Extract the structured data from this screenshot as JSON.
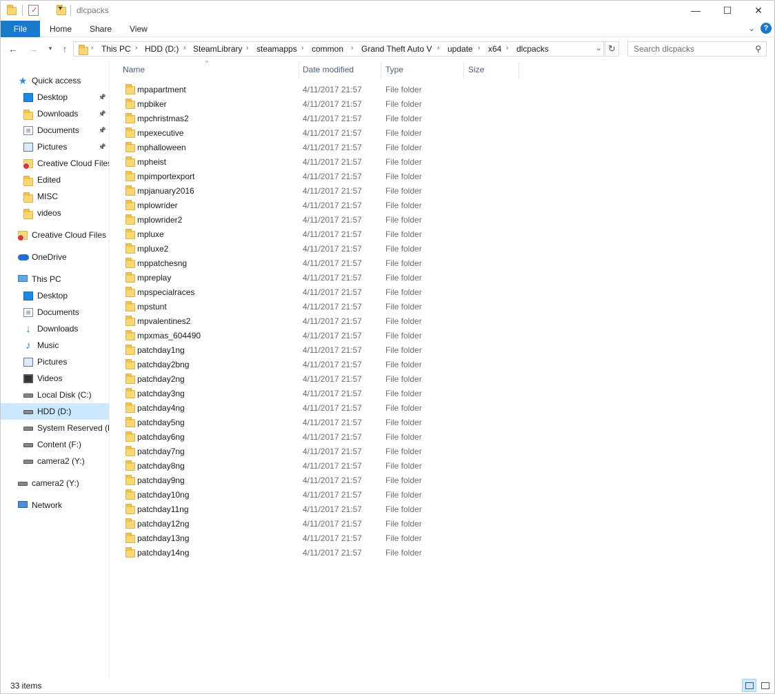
{
  "window": {
    "title": "dlcpacks",
    "minimize": "—",
    "maximize": "☐",
    "close": "✕"
  },
  "ribbon": {
    "tabs": [
      "File",
      "Home",
      "Share",
      "View"
    ],
    "help": "?",
    "collapse": "⌄"
  },
  "address": {
    "crumbs": [
      "This PC",
      "HDD (D:)",
      "SteamLibrary",
      "steamapps",
      "common",
      "Grand Theft Auto V",
      "update",
      "x64",
      "dlcpacks"
    ]
  },
  "search": {
    "placeholder": "Search dlcpacks"
  },
  "nav": {
    "items": [
      {
        "label": "Quick access",
        "icon": "star-icon"
      },
      {
        "label": "Desktop",
        "icon": "desktop-icon",
        "pinned": true
      },
      {
        "label": "Downloads",
        "icon": "folder-icon",
        "pinned": true
      },
      {
        "label": "Documents",
        "icon": "documents-icon",
        "pinned": true
      },
      {
        "label": "Pictures",
        "icon": "pictures-icon",
        "pinned": true
      },
      {
        "label": "Creative Cloud Files",
        "icon": "creative-cloud-icon"
      },
      {
        "label": "Edited",
        "icon": "folder-icon"
      },
      {
        "label": "MISC",
        "icon": "folder-icon"
      },
      {
        "label": "videos",
        "icon": "folder-icon"
      },
      {
        "label": "Creative Cloud Files",
        "icon": "creative-cloud-icon"
      },
      {
        "label": "OneDrive",
        "icon": "cloud-icon"
      },
      {
        "label": "This PC",
        "icon": "computer-icon"
      },
      {
        "label": "Desktop",
        "icon": "desktop-icon"
      },
      {
        "label": "Documents",
        "icon": "documents-icon"
      },
      {
        "label": "Downloads",
        "icon": "download-icon"
      },
      {
        "label": "Music",
        "icon": "music-icon"
      },
      {
        "label": "Pictures",
        "icon": "pictures-icon"
      },
      {
        "label": "Videos",
        "icon": "video-icon"
      },
      {
        "label": "Local Disk (C:)",
        "icon": "disk-icon"
      },
      {
        "label": "HDD (D:)",
        "icon": "disk-icon",
        "selected": true
      },
      {
        "label": "System Reserved (E:",
        "icon": "disk-icon"
      },
      {
        "label": "Content (F:)",
        "icon": "disk-icon"
      },
      {
        "label": "camera2 (Y:)",
        "icon": "disk-icon"
      },
      {
        "label": "camera2 (Y:)",
        "icon": "disk-icon"
      },
      {
        "label": "Network",
        "icon": "network-icon"
      }
    ]
  },
  "columns": {
    "name": "Name",
    "date": "Date modified",
    "type": "Type",
    "size": "Size"
  },
  "files": [
    {
      "name": "mpapartment",
      "date": "4/11/2017 21:57",
      "type": "File folder"
    },
    {
      "name": "mpbiker",
      "date": "4/11/2017 21:57",
      "type": "File folder"
    },
    {
      "name": "mpchristmas2",
      "date": "4/11/2017 21:57",
      "type": "File folder"
    },
    {
      "name": "mpexecutive",
      "date": "4/11/2017 21:57",
      "type": "File folder"
    },
    {
      "name": "mphalloween",
      "date": "4/11/2017 21:57",
      "type": "File folder"
    },
    {
      "name": "mpheist",
      "date": "4/11/2017 21:57",
      "type": "File folder"
    },
    {
      "name": "mpimportexport",
      "date": "4/11/2017 21:57",
      "type": "File folder"
    },
    {
      "name": "mpjanuary2016",
      "date": "4/11/2017 21:57",
      "type": "File folder"
    },
    {
      "name": "mplowrider",
      "date": "4/11/2017 21:57",
      "type": "File folder"
    },
    {
      "name": "mplowrider2",
      "date": "4/11/2017 21:57",
      "type": "File folder"
    },
    {
      "name": "mpluxe",
      "date": "4/11/2017 21:57",
      "type": "File folder"
    },
    {
      "name": "mpluxe2",
      "date": "4/11/2017 21:57",
      "type": "File folder"
    },
    {
      "name": "mppatchesng",
      "date": "4/11/2017 21:57",
      "type": "File folder"
    },
    {
      "name": "mpreplay",
      "date": "4/11/2017 21:57",
      "type": "File folder"
    },
    {
      "name": "mpspecialraces",
      "date": "4/11/2017 21:57",
      "type": "File folder"
    },
    {
      "name": "mpstunt",
      "date": "4/11/2017 21:57",
      "type": "File folder"
    },
    {
      "name": "mpvalentines2",
      "date": "4/11/2017 21:57",
      "type": "File folder"
    },
    {
      "name": "mpxmas_604490",
      "date": "4/11/2017 21:57",
      "type": "File folder"
    },
    {
      "name": "patchday1ng",
      "date": "4/11/2017 21:57",
      "type": "File folder"
    },
    {
      "name": "patchday2bng",
      "date": "4/11/2017 21:57",
      "type": "File folder"
    },
    {
      "name": "patchday2ng",
      "date": "4/11/2017 21:57",
      "type": "File folder"
    },
    {
      "name": "patchday3ng",
      "date": "4/11/2017 21:57",
      "type": "File folder"
    },
    {
      "name": "patchday4ng",
      "date": "4/11/2017 21:57",
      "type": "File folder"
    },
    {
      "name": "patchday5ng",
      "date": "4/11/2017 21:57",
      "type": "File folder"
    },
    {
      "name": "patchday6ng",
      "date": "4/11/2017 21:57",
      "type": "File folder"
    },
    {
      "name": "patchday7ng",
      "date": "4/11/2017 21:57",
      "type": "File folder"
    },
    {
      "name": "patchday8ng",
      "date": "4/11/2017 21:57",
      "type": "File folder"
    },
    {
      "name": "patchday9ng",
      "date": "4/11/2017 21:57",
      "type": "File folder"
    },
    {
      "name": "patchday10ng",
      "date": "4/11/2017 21:57",
      "type": "File folder"
    },
    {
      "name": "patchday11ng",
      "date": "4/11/2017 21:57",
      "type": "File folder"
    },
    {
      "name": "patchday12ng",
      "date": "4/11/2017 21:57",
      "type": "File folder"
    },
    {
      "name": "patchday13ng",
      "date": "4/11/2017 21:57",
      "type": "File folder"
    },
    {
      "name": "patchday14ng",
      "date": "4/11/2017 21:57",
      "type": "File folder"
    }
  ],
  "status": {
    "item_count": "33 items"
  },
  "colors": {
    "accent": "#1979ca",
    "selection": "#cce8ff",
    "header_text": "#4c607a"
  }
}
